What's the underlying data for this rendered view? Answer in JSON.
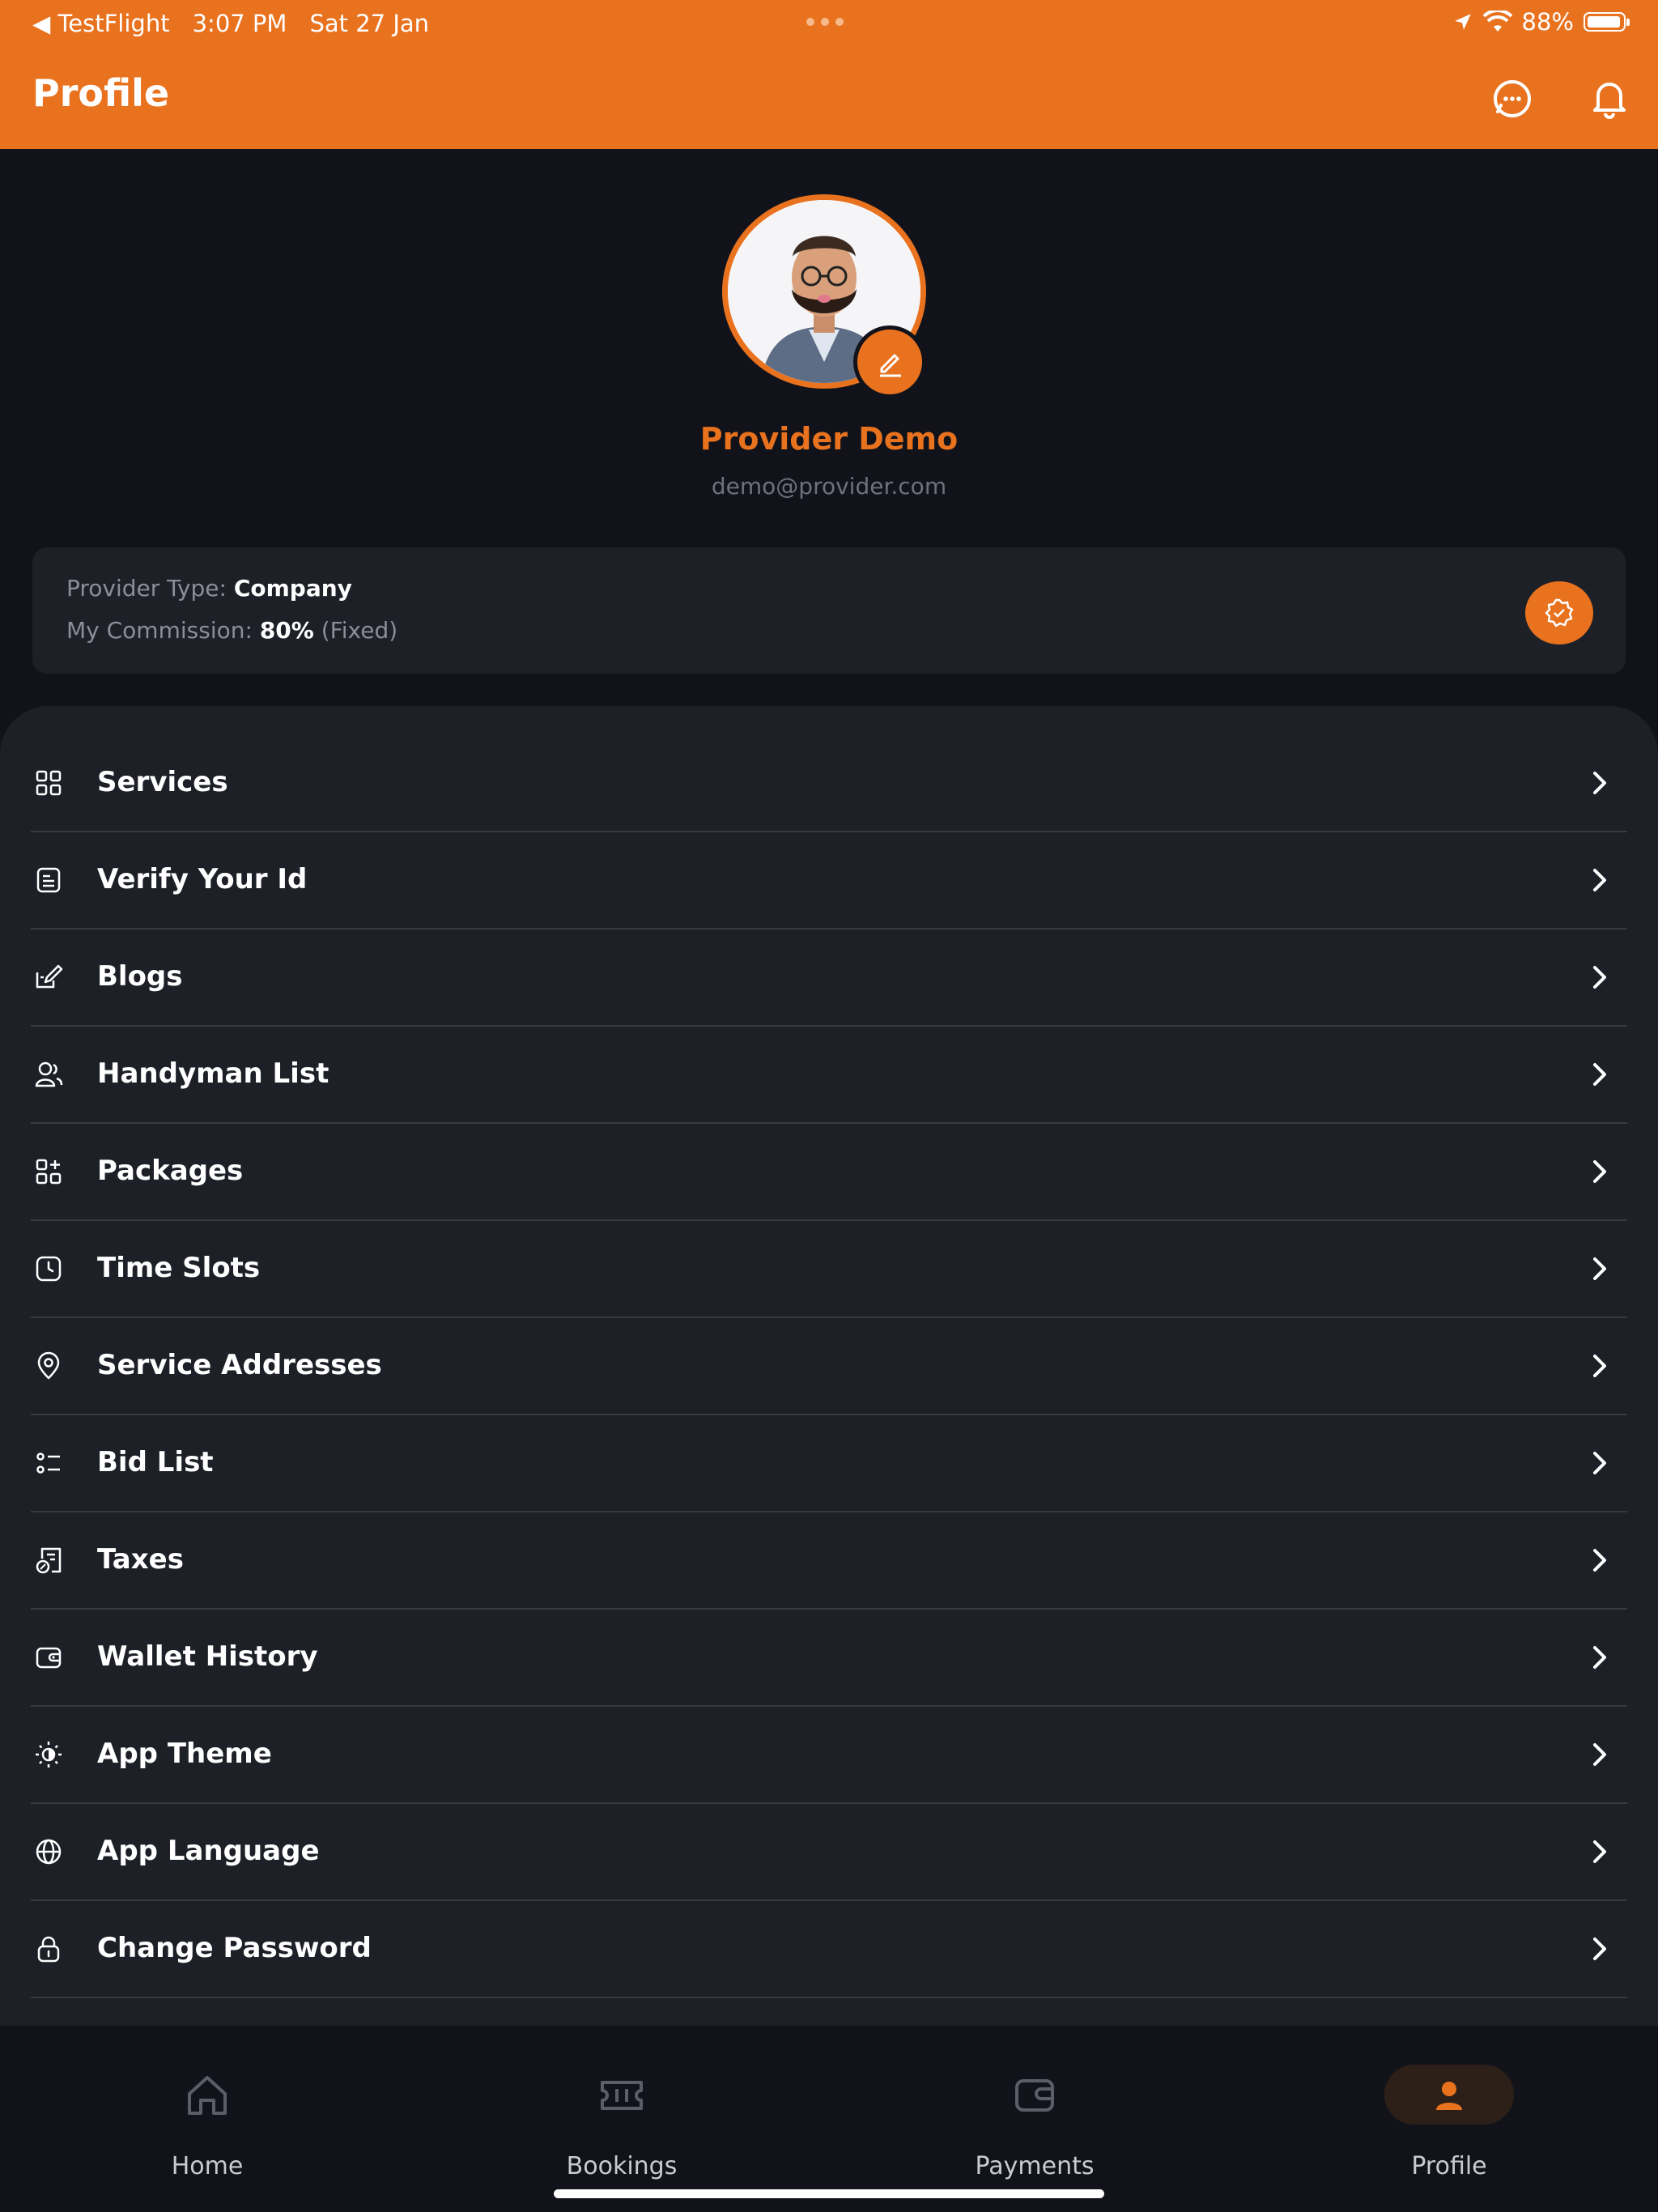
{
  "status_bar": {
    "back_app": "◀ TestFlight",
    "time": "3:07 PM",
    "date": "Sat 27 Jan",
    "battery": "88%"
  },
  "header": {
    "title": "Profile"
  },
  "profile": {
    "name": "Provider Demo",
    "email": "demo@provider.com"
  },
  "info_card": {
    "provider_type_label": "Provider Type: ",
    "provider_type_value": "Company",
    "commission_label": "My Commission: ",
    "commission_value": "80%",
    "commission_note": " (Fixed)"
  },
  "menu": {
    "items": [
      {
        "label": "Services",
        "icon": "grid-icon"
      },
      {
        "label": "Verify Your Id",
        "icon": "id-document-icon"
      },
      {
        "label": "Blogs",
        "icon": "blog-edit-icon"
      },
      {
        "label": "Handyman List",
        "icon": "users-icon"
      },
      {
        "label": "Packages",
        "icon": "package-grid-icon"
      },
      {
        "label": "Time Slots",
        "icon": "clock-icon"
      },
      {
        "label": "Service Addresses",
        "icon": "location-pin-icon"
      },
      {
        "label": "Bid List",
        "icon": "list-icon"
      },
      {
        "label": "Taxes",
        "icon": "tax-receipt-icon"
      },
      {
        "label": "Wallet History",
        "icon": "wallet-icon"
      },
      {
        "label": "App Theme",
        "icon": "sun-icon"
      },
      {
        "label": "App Language",
        "icon": "globe-icon"
      },
      {
        "label": "Change Password",
        "icon": "lock-icon"
      }
    ]
  },
  "tabs": [
    {
      "label": "Home",
      "icon": "home-icon"
    },
    {
      "label": "Bookings",
      "icon": "ticket-icon"
    },
    {
      "label": "Payments",
      "icon": "wallet-icon"
    },
    {
      "label": "Profile",
      "icon": "user-icon",
      "active": true
    }
  ],
  "colors": {
    "accent": "#e9721f",
    "background": "#12131a",
    "card": "#1e2028"
  }
}
